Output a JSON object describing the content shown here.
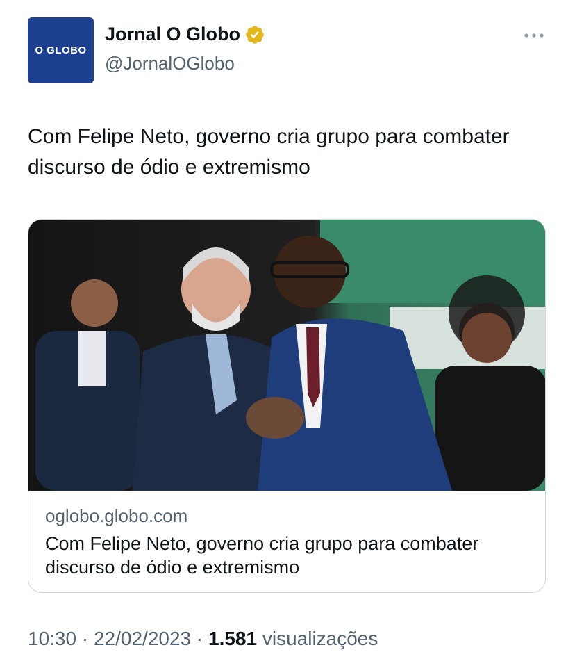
{
  "account": {
    "avatar_text": "O GLOBO",
    "display_name": "Jornal O Globo",
    "handle": "@JornalOGlobo",
    "verified_icon": "verified-gold-badge-icon"
  },
  "tweet": {
    "text": "Com Felipe Neto, governo cria grupo para combater discurso de ódio e extremismo"
  },
  "card": {
    "image_icon": "news-photo",
    "domain": "oglobo.globo.com",
    "title": "Com Felipe Neto, governo cria grupo para combater discurso de ódio e extremismo"
  },
  "meta": {
    "time": "10:30",
    "separator": " · ",
    "date": "22/02/2023",
    "views_count": "1.581",
    "views_label": "visualizações"
  },
  "colors": {
    "brand_blue": "#1d3f8f",
    "verified_gold": "#e2b719",
    "secondary_text": "#536471",
    "primary_text": "#0f1419",
    "border": "#cfd9de"
  }
}
